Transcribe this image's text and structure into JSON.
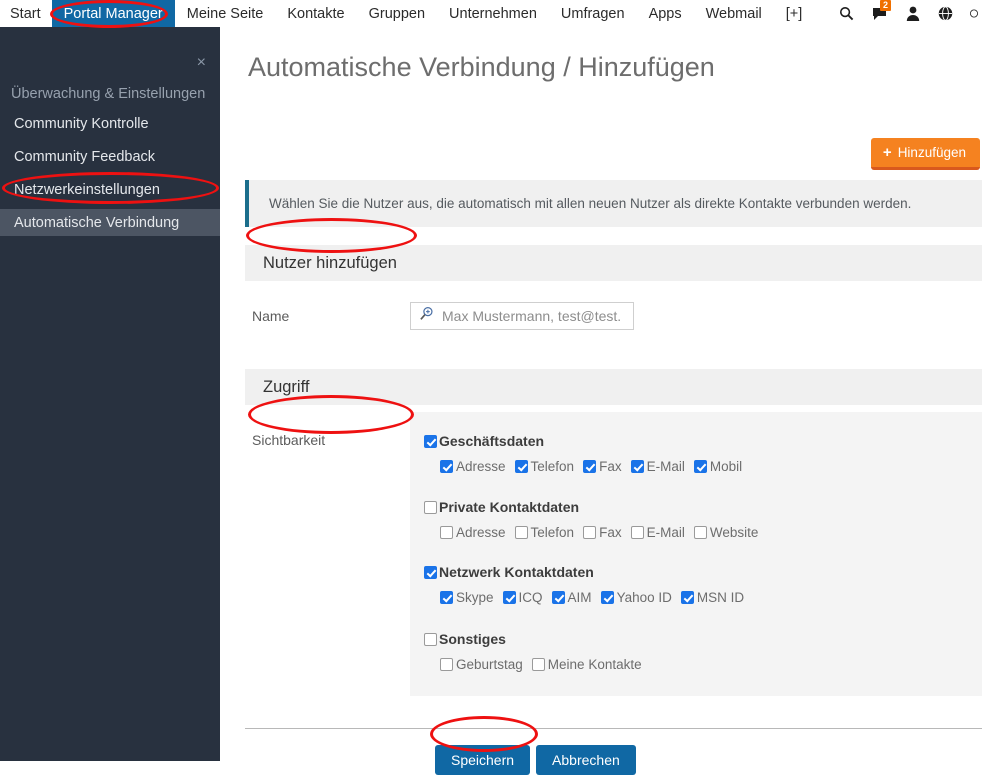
{
  "topnav": {
    "items": [
      {
        "label": "Start",
        "active": false
      },
      {
        "label": "Portal Manager",
        "active": true
      },
      {
        "label": "Meine Seite",
        "active": false
      },
      {
        "label": "Kontakte",
        "active": false
      },
      {
        "label": "Gruppen",
        "active": false
      },
      {
        "label": "Unternehmen",
        "active": false
      },
      {
        "label": "Umfragen",
        "active": false
      },
      {
        "label": "Apps",
        "active": false
      },
      {
        "label": "Webmail",
        "active": false
      },
      {
        "label": "[+]",
        "active": false
      }
    ],
    "icons": [
      {
        "name": "search-icon",
        "glyph": "⌕"
      },
      {
        "name": "messages-icon",
        "glyph": "⚑",
        "badge": "2"
      },
      {
        "name": "profile-icon",
        "glyph": "♟"
      },
      {
        "name": "globe-icon",
        "glyph": "ἱ0"
      },
      {
        "name": "more-icon",
        "glyph": "●"
      }
    ],
    "badge_color": "#f07000",
    "active_color": "#1068a4"
  },
  "sidebar": {
    "close_label": "×",
    "heading": "Überwachung & Einstellungen",
    "items": [
      {
        "label": "Community Kontrolle",
        "selected": false
      },
      {
        "label": "Community Feedback",
        "selected": false
      },
      {
        "label": "Netzwerkeinstellungen",
        "selected": false
      },
      {
        "label": "Automatische Verbindung",
        "selected": true
      }
    ],
    "background": "#28313f",
    "selected_background": "#4c5563"
  },
  "main": {
    "page_title": "Automatische Verbindung / Hinzufügen",
    "add_button": {
      "label": "Hinzufügen",
      "icon": "plus-icon",
      "color": "#f58220"
    },
    "info_text": "Wählen Sie die Nutzer aus, die automatisch mit allen neuen Nutzer als direkte Kontakte verbunden werden.",
    "info_accent": "#1b6e8c",
    "section_user": {
      "heading": "Nutzer hinzufügen",
      "name_label": "Name",
      "name_value": "",
      "name_placeholder": "Max Mustermann, test@test.",
      "name_icon": "search-plus-icon"
    },
    "section_access": {
      "heading": "Zugriff",
      "visibility_label": "Sichtbarkeit",
      "groups": [
        {
          "label": "Geschäftsdaten",
          "checked": true,
          "options": [
            {
              "label": "Adresse",
              "checked": true
            },
            {
              "label": "Telefon",
              "checked": true
            },
            {
              "label": "Fax",
              "checked": true
            },
            {
              "label": "E-Mail",
              "checked": true
            },
            {
              "label": "Mobil",
              "checked": true
            }
          ]
        },
        {
          "label": "Private Kontaktdaten",
          "checked": false,
          "options": [
            {
              "label": "Adresse",
              "checked": false
            },
            {
              "label": "Telefon",
              "checked": false
            },
            {
              "label": "Fax",
              "checked": false
            },
            {
              "label": "E-Mail",
              "checked": false
            },
            {
              "label": "Website",
              "checked": false
            }
          ]
        },
        {
          "label": "Netzwerk Kontaktdaten",
          "checked": true,
          "options": [
            {
              "label": "Skype",
              "checked": true
            },
            {
              "label": "ICQ",
              "checked": true
            },
            {
              "label": "AIM",
              "checked": true
            },
            {
              "label": "Yahoo ID",
              "checked": true
            },
            {
              "label": "MSN ID",
              "checked": true
            }
          ]
        },
        {
          "label": "Sonstiges",
          "checked": false,
          "options": [
            {
              "label": "Geburtstag",
              "checked": false
            },
            {
              "label": "Meine Kontakte",
              "checked": false
            }
          ]
        }
      ]
    },
    "buttons": {
      "save": "Speichern",
      "cancel": "Abbrechen",
      "color": "#1068a4"
    }
  },
  "annotations": {
    "color": "#ee1111",
    "marks": [
      "portal-manager-nav",
      "automatische-verbindung-sidebar",
      "nutzer-hinzufuegen-header",
      "sichtbarkeit-label",
      "speichern-button"
    ]
  }
}
